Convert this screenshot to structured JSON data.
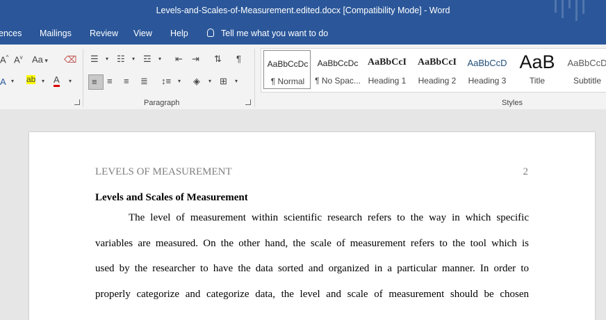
{
  "window": {
    "title": "Levels-and-Scales-of-Measurement.edited.docx [Compatibility Mode]  -  Word"
  },
  "menu": {
    "items": [
      "ences",
      "Mailings",
      "Review",
      "View",
      "Help"
    ],
    "tell_me": "Tell me what you want to do"
  },
  "ribbon": {
    "font": {
      "change_case": "Aa",
      "font_color_letter": "A"
    },
    "paragraph": {
      "label": "Paragraph",
      "pilcrow": "¶"
    },
    "styles": {
      "label": "Styles",
      "items": [
        {
          "preview": "AaBbCcDc",
          "name": "¶ Normal",
          "selected": true
        },
        {
          "preview": "AaBbCcDc",
          "name": "¶ No Spac..."
        },
        {
          "preview": "AaBbCcI",
          "name": "Heading 1"
        },
        {
          "preview": "AaBbCcI",
          "name": "Heading 2"
        },
        {
          "preview": "AaBbCcD",
          "name": "Heading 3"
        },
        {
          "preview": "AaB",
          "name": "Title"
        },
        {
          "preview": "AaBbCcD",
          "name": "Subtitle"
        }
      ]
    }
  },
  "document": {
    "header_left": "LEVELS OF MEASUREMENT",
    "page_number": "2",
    "heading": "Levels and Scales of Measurement",
    "lines": [
      "The level of measurement within scientific research refers to the way in which specific",
      "variables are measured. On the other hand, the scale of measurement refers to the tool which is",
      "used by the researcher to have the data sorted and organized in a particular manner.  In order to",
      "properly categorize and categorize data, the level and scale of measurement should be chosen"
    ]
  },
  "colors": {
    "title_bar": "#2b579a",
    "ribbon": "#f3f3f3",
    "canvas": "#e6e6e6"
  }
}
